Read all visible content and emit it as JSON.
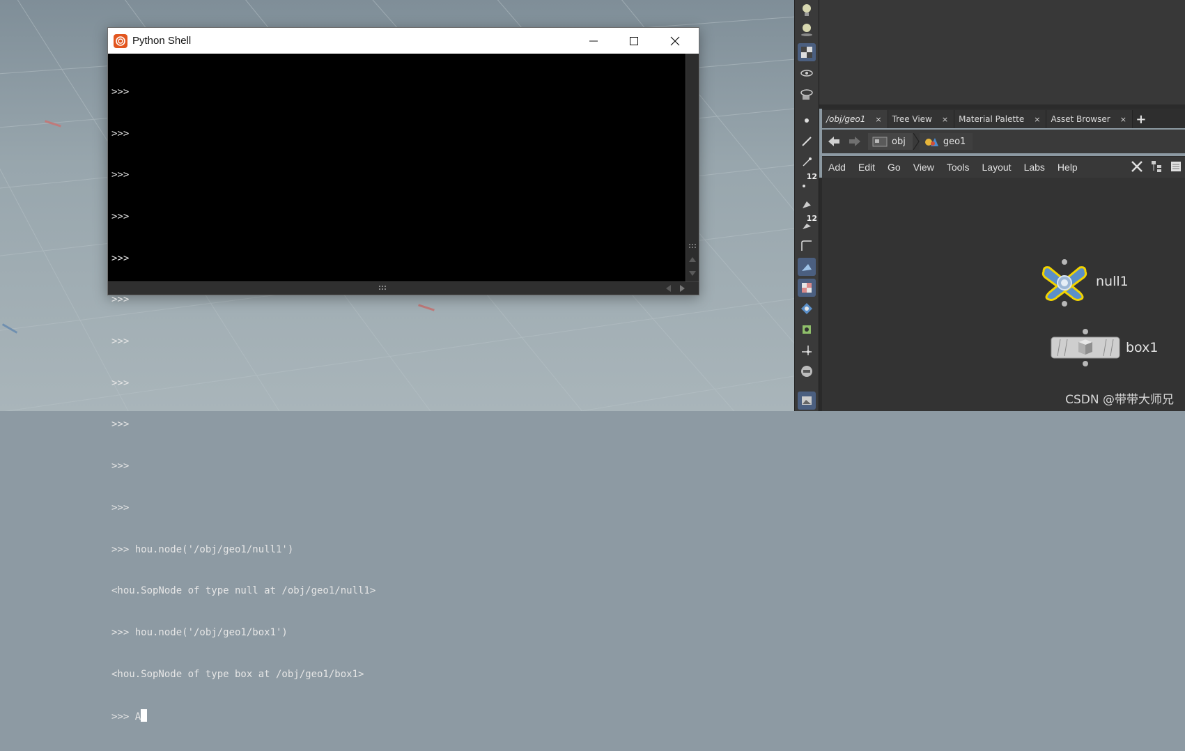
{
  "shell": {
    "title": "Python Shell",
    "console_lines": [
      ">>>",
      ">>>",
      ">>>",
      ">>>",
      ">>>",
      ">>>",
      ">>>",
      ">>>",
      ">>>",
      ">>>",
      ">>>",
      ">>> hou.node('/obj/geo1/null1')",
      "<hou.SopNode of type null at /obj/geo1/null1>",
      ">>> hou.node('/obj/geo1/box1')",
      "<hou.SopNode of type box at /obj/geo1/box1>"
    ],
    "input_line": ">>> A"
  },
  "tabs": [
    {
      "label": "/obj/geo1",
      "close": "×"
    },
    {
      "label": "Tree View",
      "close": "×"
    },
    {
      "label": "Material Palette",
      "close": "×"
    },
    {
      "label": "Asset Browser",
      "close": "×"
    }
  ],
  "tab_add": "+",
  "path": {
    "obj": "obj",
    "geo": "geo1"
  },
  "menu": [
    "Add",
    "Edit",
    "Go",
    "View",
    "Tools",
    "Layout",
    "Labs",
    "Help"
  ],
  "shelf_numbers": [
    "12",
    "12"
  ],
  "nodes": {
    "null": "null1",
    "box": "box1"
  },
  "watermark": "CSDN @带带大师兄",
  "colors": {
    "houdini_orange": "#e2561f",
    "null_node_yellow": "#f2d400",
    "null_node_blue": "#5b8fc8"
  }
}
